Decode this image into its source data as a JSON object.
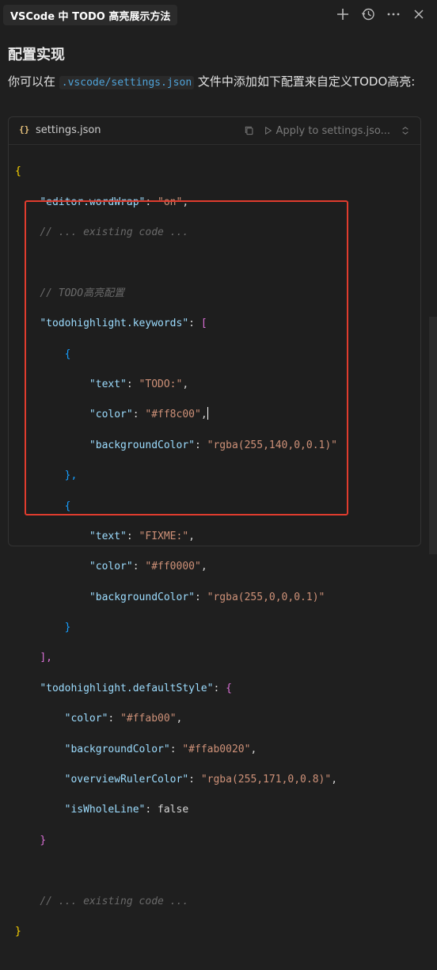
{
  "header": {
    "title": "VSCode 中 TODO 高亮展示方法",
    "actions": [
      "plus-icon",
      "history-icon",
      "more-icon",
      "close-icon"
    ]
  },
  "content": {
    "heading": "配置实现",
    "para_before": "你可以在 ",
    "para_code": ".vscode/settings.json",
    "para_after": " 文件中添加如下配置来自定义TODO高亮:"
  },
  "codeblock": {
    "file_icon": "{}",
    "file_name": "settings.json",
    "apply_label": "Apply to settings.jso...",
    "lines": {
      "l1": "{",
      "l2_key": "\"editor.wordWrap\"",
      "l2_val": "\"on\"",
      "l3": "// ... existing code ...",
      "l4": "// TODO高亮配置",
      "l5_key": "\"todohighlight.keywords\"",
      "l5_open": "[",
      "l6": "{",
      "l7_key": "\"text\"",
      "l7_val": "\"TODO:\"",
      "l8_key": "\"color\"",
      "l8_val": "\"#ff8c00\"",
      "l9_key": "\"backgroundColor\"",
      "l9_val": "\"rgba(255,140,0,0.1)\"",
      "l10": "},",
      "l11": "{",
      "l12_key": "\"text\"",
      "l12_val": "\"FIXME:\"",
      "l13_key": "\"color\"",
      "l13_val": "\"#ff0000\"",
      "l14_key": "\"backgroundColor\"",
      "l14_val": "\"rgba(255,0,0,0.1)\"",
      "l15": "}",
      "l16": "],",
      "l17_key": "\"todohighlight.defaultStyle\"",
      "l17_open": "{",
      "l18_key": "\"color\"",
      "l18_val": "\"#ffab00\"",
      "l19_key": "\"backgroundColor\"",
      "l19_val": "\"#ffab0020\"",
      "l20_key": "\"overviewRulerColor\"",
      "l20_val": "\"rgba(255,171,0,0.8)\"",
      "l21_key": "\"isWholeLine\"",
      "l21_val": "false",
      "l22": "}",
      "l23": "// ... existing code ...",
      "l24": "}"
    }
  },
  "colors": {
    "background": "#1f1f1f",
    "highlight_border": "#e03c2e",
    "string": "#ce9178",
    "key": "#9cdcfe",
    "comment": "#6a6a6a"
  }
}
